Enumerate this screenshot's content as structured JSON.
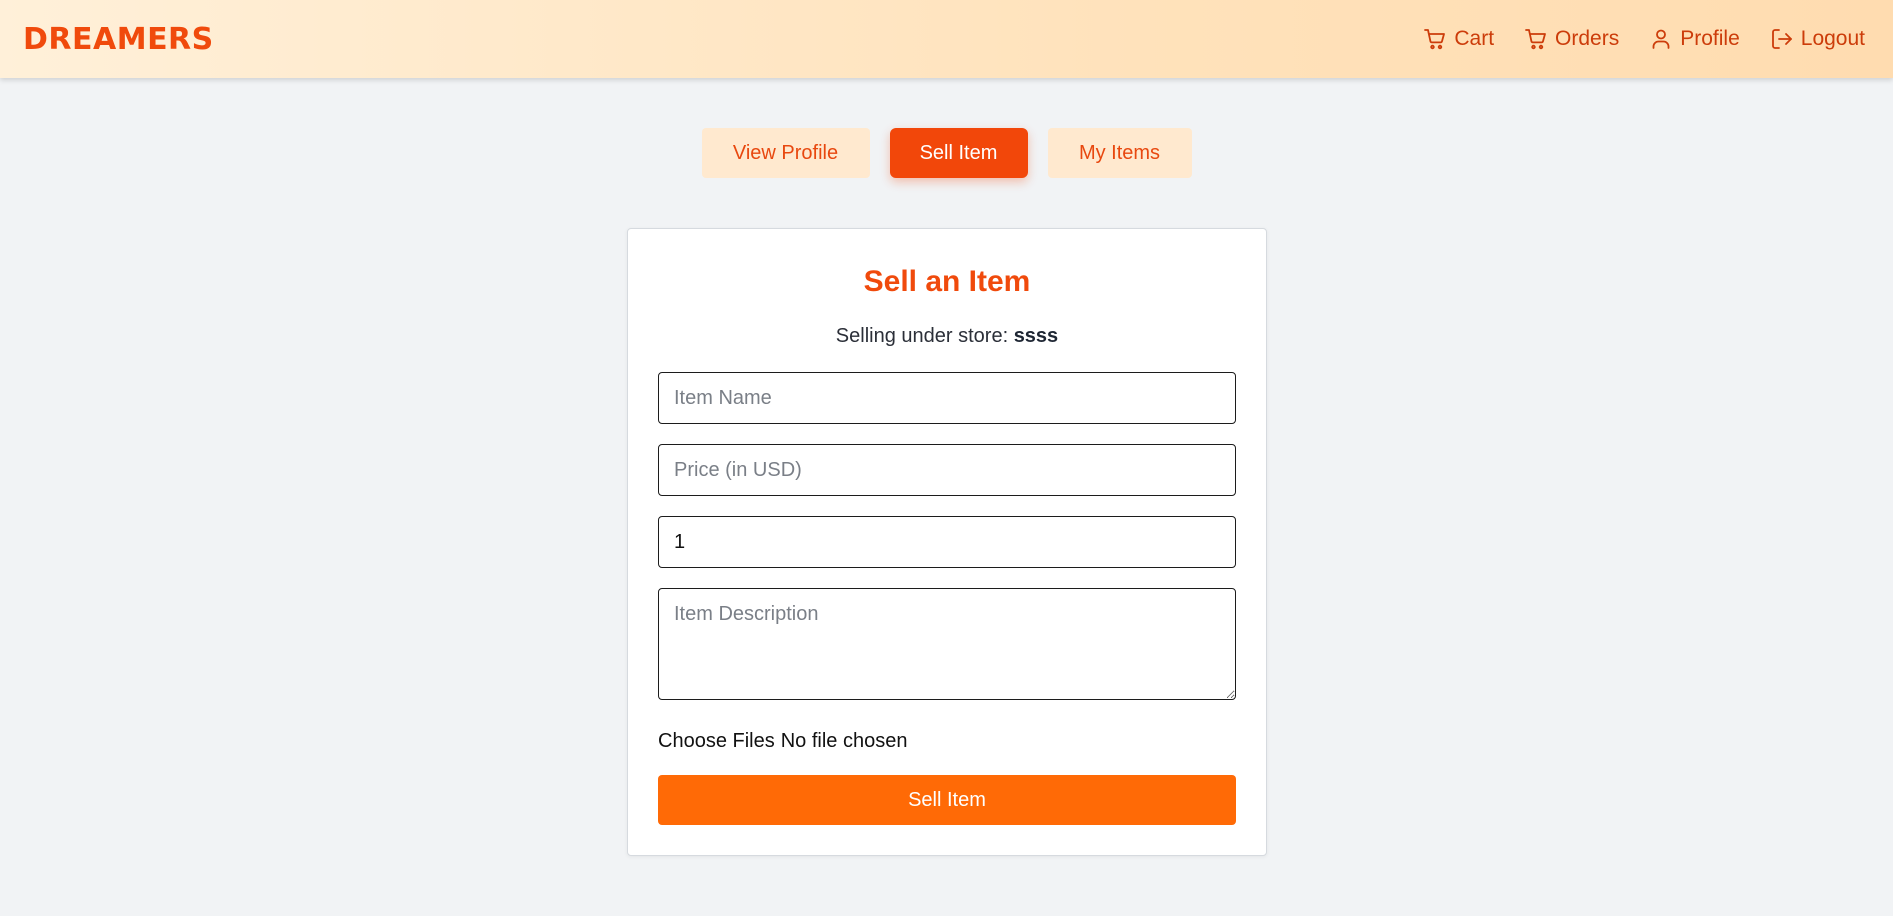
{
  "header": {
    "brand": "DREAMERS",
    "nav": [
      {
        "label": "Cart",
        "icon": "cart-icon"
      },
      {
        "label": "Orders",
        "icon": "cart-icon"
      },
      {
        "label": "Profile",
        "icon": "user-icon"
      },
      {
        "label": "Logout",
        "icon": "logout-icon"
      }
    ]
  },
  "tabs": [
    {
      "label": "View Profile",
      "active": false
    },
    {
      "label": "Sell Item",
      "active": true
    },
    {
      "label": "My Items",
      "active": false
    }
  ],
  "form": {
    "title": "Sell an Item",
    "store_prefix": "Selling under store: ",
    "store_name": "ssss",
    "item_name": {
      "placeholder": "Item Name",
      "value": ""
    },
    "price": {
      "placeholder": "Price (in USD)",
      "value": ""
    },
    "quantity": {
      "value": "1"
    },
    "description": {
      "placeholder": "Item Description",
      "value": ""
    },
    "file_button": "Choose Files",
    "file_status": "No file chosen",
    "submit_label": "Sell Item"
  },
  "colors": {
    "brand": "#f04a0c",
    "nav_text": "#cc3c0a",
    "active_tab": "#f2470a",
    "inactive_tab_bg": "#ffe9cf",
    "submit_bg": "#ff6a06",
    "page_bg": "#f1f3f5"
  }
}
